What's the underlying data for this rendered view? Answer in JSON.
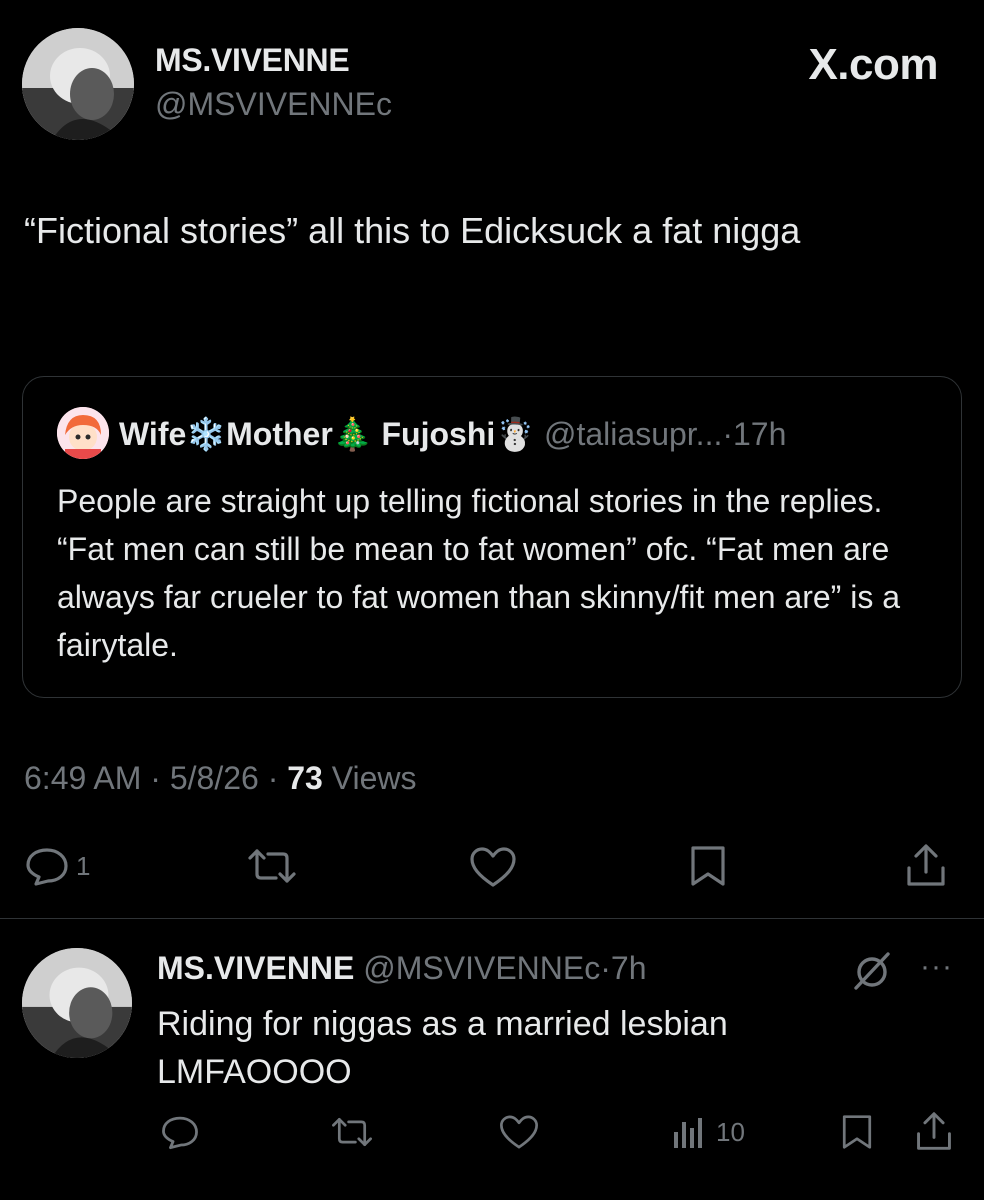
{
  "brand": "X.com",
  "author": {
    "name": "MS.VIVENNE",
    "handle": "@MSVIVENNEc"
  },
  "tweet": {
    "text": "“Fictional stories” all this to Edicksuck a fat nigga"
  },
  "quote": {
    "name": "Wife❄️Mother🎄 Fujoshi☃️",
    "handle": "@taliasupr...",
    "separator": "·",
    "time": "17h",
    "text": "People are straight up telling fictional stories in the replies. “Fat men can still be mean to fat women” ofc. “Fat men are always far crueler to fat women than skinny/fit men are” is a fairytale."
  },
  "meta": {
    "time": "6:49 AM",
    "sep1": "·",
    "date": "5/8/26",
    "sep2": "·",
    "views_count": "73",
    "views_label": "Views"
  },
  "actions": {
    "reply_count": "1",
    "icons": [
      "reply-icon",
      "retweet-icon",
      "like-icon",
      "bookmark-icon",
      "share-icon"
    ]
  },
  "reply": {
    "name": "MS.VIVENNE",
    "handle": "@MSVIVENNEc",
    "separator": "·",
    "time": "7h",
    "text": "Riding for niggas as a married lesbian LMFAOOOO",
    "more": "···",
    "views_count": "10"
  },
  "colors": {
    "background": "#000000",
    "text": "#e7e9ea",
    "muted": "#71767b",
    "border": "#2f3336"
  }
}
